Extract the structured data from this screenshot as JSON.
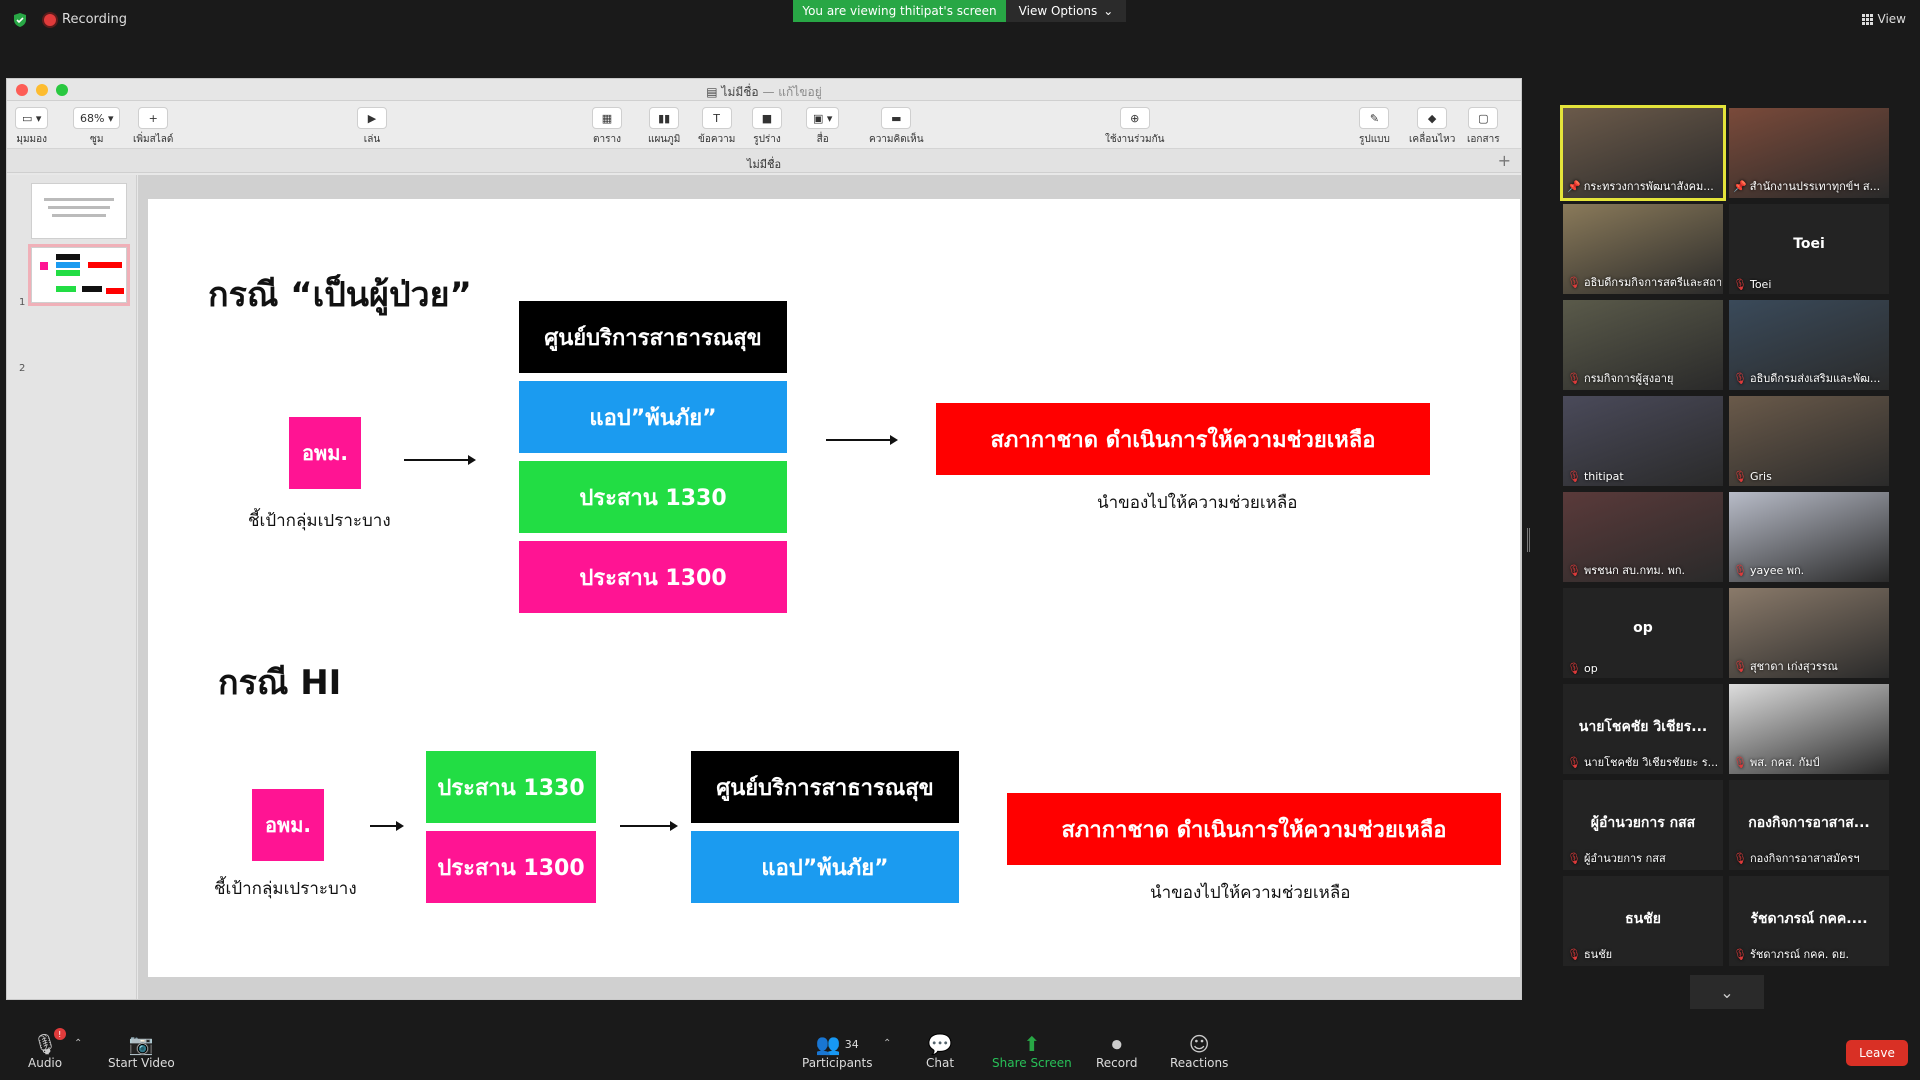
{
  "topbar": {
    "recording_label": "Recording",
    "viewing_banner": "You are viewing thitipat's screen",
    "view_options": "View Options",
    "view_label": "View"
  },
  "keynote": {
    "window_title": "ไม่มีชื่อ",
    "window_subtitle": "— แก้ไขอยู่",
    "doc_tab": "ไม่มีชื่อ",
    "toolbar": [
      {
        "label": "มุมมอง",
        "box": "▭ ▾"
      },
      {
        "label": "ซูม",
        "box": "68% ▾"
      },
      {
        "label": "เพิ่มสไลด์",
        "box": "+"
      },
      {
        "label": "เล่น",
        "box": "▶"
      },
      {
        "label": "ตาราง",
        "box": "▦"
      },
      {
        "label": "แผนภูมิ",
        "box": "▮▮"
      },
      {
        "label": "ข้อความ",
        "box": "T"
      },
      {
        "label": "รูปร่าง",
        "box": "■"
      },
      {
        "label": "สื่อ",
        "box": "▣ ▾"
      },
      {
        "label": "ความคิดเห็น",
        "box": "▬"
      },
      {
        "label": "ใช้งานร่วมกัน",
        "box": "⊕"
      },
      {
        "label": "รูปแบบ",
        "box": "✎"
      },
      {
        "label": "เคลื่อนไหว",
        "box": "◆"
      },
      {
        "label": "เอกสาร",
        "box": "▢"
      }
    ],
    "thumbnails": [
      "1",
      "2"
    ],
    "slide": {
      "heading1": "กรณี “เป็นผู้ป่วย”",
      "heading2": "กรณี HI",
      "source": "อพม.",
      "source_caption": "ชี้เป้ากลุ่มเปราะบาง",
      "health_center": "ศูนย์บริการสาธารณสุข",
      "app": "แอป”พ้นภัย”",
      "coord_1330": "ประสาน 1330",
      "coord_1300": "ประสาน 1300",
      "redcross": "สภากาชาด ดำเนินการให้ความช่วยเหลือ",
      "redcross_caption": "นำของไปให้ความช่วยเหลือ"
    }
  },
  "participants": [
    {
      "name": "กระทรวงการพัฒนาสังคม...",
      "kind": "video",
      "bg": "#6b5a4a",
      "active": true,
      "pin": true
    },
    {
      "name": "สำนักงานปรรเทาทุกข์ฯ ส...",
      "kind": "video",
      "bg": "#7a4a3a",
      "pin": true
    },
    {
      "name": "อธิบดีกรมกิจการสตรีและสถา...",
      "kind": "video",
      "bg": "#8a7a5a"
    },
    {
      "name": "Toei",
      "kind": "name",
      "display": "Toei"
    },
    {
      "name": "กรมกิจการผู้สูงอายุ",
      "kind": "video",
      "bg": "#5a5a4a"
    },
    {
      "name": "อธิบดีกรมส่งเสริมและพัฒ...",
      "kind": "video",
      "bg": "#3a4a5a"
    },
    {
      "name": "thitipat",
      "kind": "video",
      "bg": "#4a4a5a"
    },
    {
      "name": "Gris",
      "kind": "video",
      "bg": "#6a5a4a"
    },
    {
      "name": "พรชนก สบ.กทม. พก.",
      "kind": "video",
      "bg": "#5a3a3a"
    },
    {
      "name": "yayee พก.",
      "kind": "video",
      "bg": "#b8bcc8"
    },
    {
      "name": "op",
      "kind": "name",
      "display": "op"
    },
    {
      "name": "สุชาดา เก่งสุวรรณ",
      "kind": "video",
      "bg": "#8a7a6a"
    },
    {
      "name": "นายโชคชัย วิเชียรชัยยะ ร...",
      "kind": "name",
      "display": "นายโชคชัย วิเชียร..."
    },
    {
      "name": "พส. กคส. กัมป์",
      "kind": "video",
      "bg": "#dddddd"
    },
    {
      "name": "ผู้อำนวยการ กสส",
      "kind": "name",
      "display": "ผู้อำนวยการ กสส"
    },
    {
      "name": "กองกิจการอาสาสมัครฯ",
      "kind": "name",
      "display": "กองกิจการอาสาส..."
    },
    {
      "name": "ธนชัย",
      "kind": "name",
      "display": "ธนชัย"
    },
    {
      "name": "รัชดาภรณ์ กคค. ดย.",
      "kind": "name",
      "display": "รัชดาภรณ์ กคค...."
    }
  ],
  "bottombar": {
    "audio": "Audio",
    "start_video": "Start Video",
    "participants": "Participants",
    "participant_count": "34",
    "chat": "Chat",
    "share_screen": "Share Screen",
    "record": "Record",
    "reactions": "Reactions",
    "leave": "Leave",
    "audio_badge": "!"
  }
}
